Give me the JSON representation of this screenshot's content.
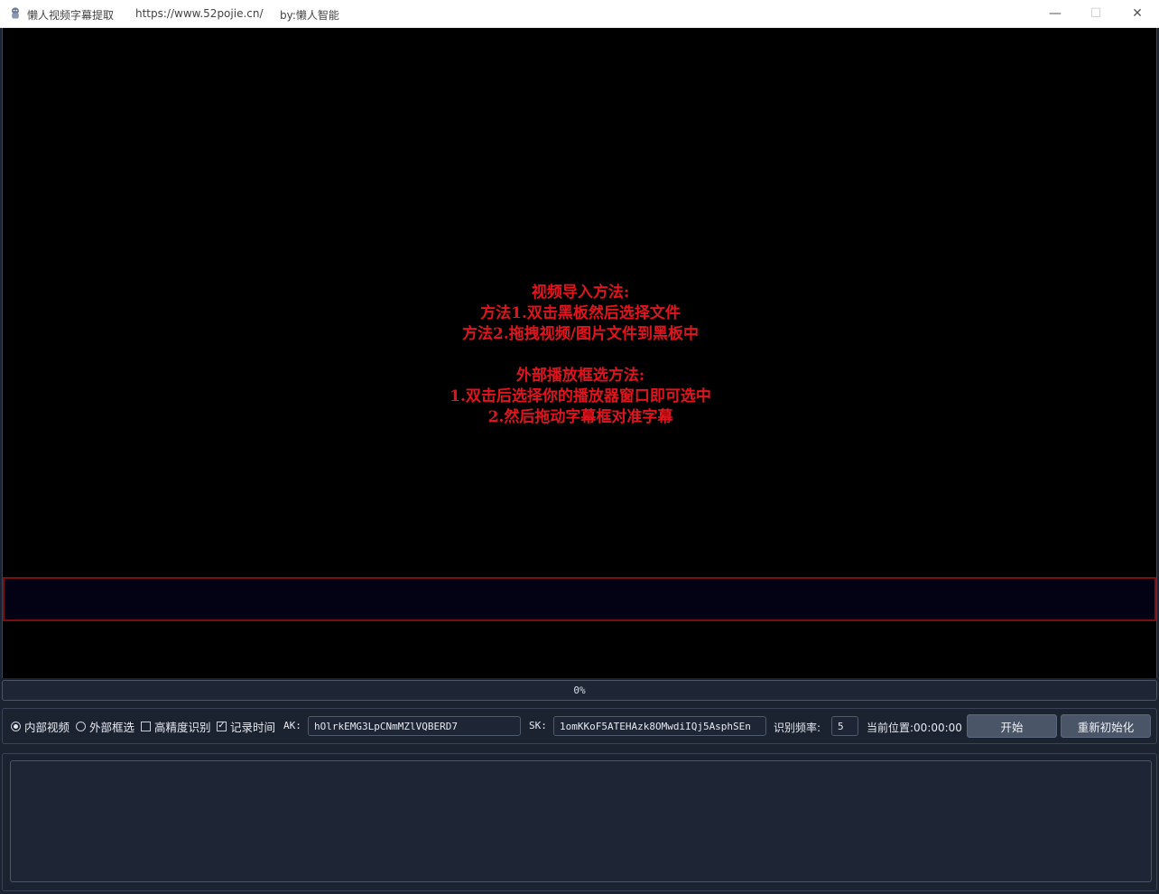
{
  "window": {
    "title": "懒人视频字幕提取",
    "url": "https://www.52pojie.cn/",
    "author": "by:懒人智能",
    "controls": {
      "minimize": "—",
      "maximize": "☐",
      "close": "✕"
    }
  },
  "board": {
    "instructions": [
      "视频导入方法:",
      "方法1.双击黑板然后选择文件",
      "方法2.拖拽视频/图片文件到黑板中",
      "",
      "外部播放框选方法:",
      "1.双击后选择你的播放器窗口即可选中",
      "2.然后拖动字幕框对准字幕"
    ]
  },
  "progress": {
    "value": 0,
    "label": "0%"
  },
  "controls": {
    "internal_video": {
      "label": "内部视频",
      "checked": true
    },
    "external_select": {
      "label": "外部框选",
      "checked": false
    },
    "high_precision": {
      "label": "高精度识别",
      "checked": false
    },
    "record_time": {
      "label": "记录时间",
      "checked": true,
      "mark": "✓"
    },
    "ak_label": "AK:",
    "ak_value": "hOlrkEMG3LpCNmMZlVQBERD7",
    "sk_label": "SK:",
    "sk_value": "1omKKoF5ATEHAzk8OMwdiIQj5AsphSEn",
    "freq_label": "识别频率:",
    "freq_value": "5",
    "position_label": "当前位置:00:00:00",
    "start_button": "开始",
    "reinit_button": "重新初始化"
  },
  "log": {
    "text": ""
  },
  "colors": {
    "accent_text": "#e0141e",
    "subtitle_border": "#7a0e16",
    "panel_bg": "#1b2230"
  }
}
